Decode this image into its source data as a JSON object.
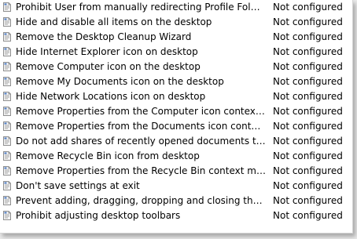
{
  "policy_list": {
    "items": [
      {
        "name": "Prohibit User from manually redirecting Profile Folders",
        "state": "Not configured",
        "icon": "policy-setting-icon"
      },
      {
        "name": "Hide and disable all items on the desktop",
        "state": "Not configured",
        "icon": "policy-setting-icon"
      },
      {
        "name": "Remove the Desktop Cleanup Wizard",
        "state": "Not configured",
        "icon": "policy-setting-icon"
      },
      {
        "name": "Hide Internet Explorer icon on desktop",
        "state": "Not configured",
        "icon": "policy-setting-icon"
      },
      {
        "name": "Remove Computer icon on the desktop",
        "state": "Not configured",
        "icon": "policy-setting-icon"
      },
      {
        "name": "Remove My Documents icon on the desktop",
        "state": "Not configured",
        "icon": "policy-setting-icon"
      },
      {
        "name": "Hide Network Locations icon on desktop",
        "state": "Not configured",
        "icon": "policy-setting-icon"
      },
      {
        "name": "Remove Properties from the Computer icon context menu",
        "state": "Not configured",
        "icon": "policy-setting-icon"
      },
      {
        "name": "Remove Properties from the Documents icon context menu",
        "state": "Not configured",
        "icon": "policy-setting-icon"
      },
      {
        "name": "Do not add shares of recently opened documents to Netw...",
        "state": "Not configured",
        "icon": "policy-setting-icon"
      },
      {
        "name": "Remove Recycle Bin icon from desktop",
        "state": "Not configured",
        "icon": "policy-setting-icon"
      },
      {
        "name": "Remove Properties from the Recycle Bin context menu",
        "state": "Not configured",
        "icon": "policy-setting-icon"
      },
      {
        "name": "Don't save settings at exit",
        "state": "Not configured",
        "icon": "policy-setting-icon"
      },
      {
        "name": "Prevent adding, dragging, dropping and closing the Taskb...",
        "state": "Not configured",
        "icon": "policy-setting-icon"
      },
      {
        "name": "Prohibit adjusting desktop toolbars",
        "state": "Not configured",
        "icon": "policy-setting-icon"
      }
    ]
  },
  "colors": {
    "icon_page": "#f6f6f6",
    "icon_border": "#8f8f8f",
    "icon_lines": "#a6a6a6",
    "icon_accent": "#4a78c0",
    "background": "#ffffff"
  }
}
